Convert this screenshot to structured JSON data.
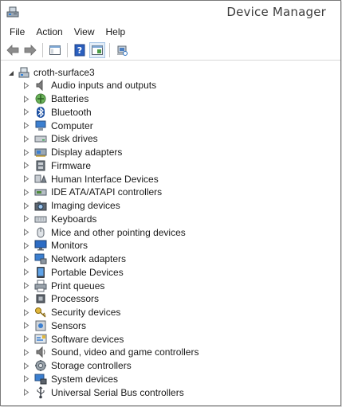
{
  "window": {
    "title": "Device Manager"
  },
  "menu": [
    "File",
    "Action",
    "View",
    "Help"
  ],
  "tree": {
    "root": "croth-surface3",
    "items": [
      {
        "label": "Audio inputs and outputs",
        "icon": "speaker-icon"
      },
      {
        "label": "Batteries",
        "icon": "battery-icon"
      },
      {
        "label": "Bluetooth",
        "icon": "bluetooth-icon"
      },
      {
        "label": "Computer",
        "icon": "computer-icon"
      },
      {
        "label": "Disk drives",
        "icon": "disk-drive-icon"
      },
      {
        "label": "Display adapters",
        "icon": "display-adapter-icon"
      },
      {
        "label": "Firmware",
        "icon": "firmware-icon"
      },
      {
        "label": "Human Interface Devices",
        "icon": "hid-icon"
      },
      {
        "label": "IDE ATA/ATAPI controllers",
        "icon": "ide-controller-icon"
      },
      {
        "label": "Imaging devices",
        "icon": "camera-icon"
      },
      {
        "label": "Keyboards",
        "icon": "keyboard-icon"
      },
      {
        "label": "Mice and other pointing devices",
        "icon": "mouse-icon"
      },
      {
        "label": "Monitors",
        "icon": "monitor-icon"
      },
      {
        "label": "Network adapters",
        "icon": "network-adapter-icon"
      },
      {
        "label": "Portable Devices",
        "icon": "portable-device-icon"
      },
      {
        "label": "Print queues",
        "icon": "printer-icon"
      },
      {
        "label": "Processors",
        "icon": "processor-icon"
      },
      {
        "label": "Security devices",
        "icon": "security-key-icon"
      },
      {
        "label": "Sensors",
        "icon": "sensor-icon"
      },
      {
        "label": "Software devices",
        "icon": "software-device-icon"
      },
      {
        "label": "Sound, video and game controllers",
        "icon": "sound-controller-icon"
      },
      {
        "label": "Storage controllers",
        "icon": "storage-controller-icon"
      },
      {
        "label": "System devices",
        "icon": "system-device-icon"
      },
      {
        "label": "Universal Serial Bus controllers",
        "icon": "usb-icon"
      }
    ]
  }
}
